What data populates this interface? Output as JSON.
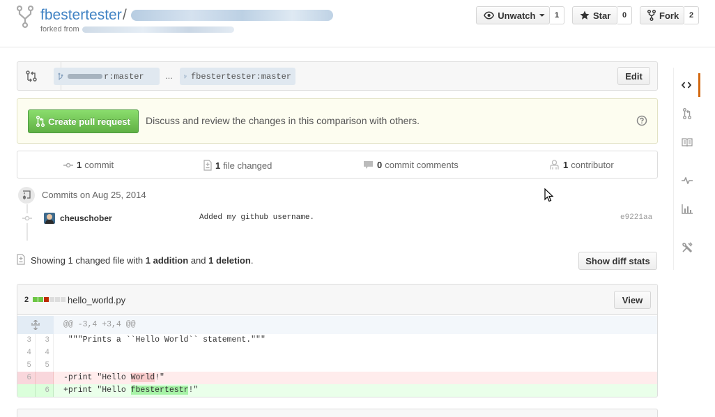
{
  "header": {
    "owner": "fbestertester",
    "slash": "/",
    "forked_from_label": "forked from",
    "unwatch": {
      "label": "Unwatch",
      "count": "1"
    },
    "star": {
      "label": "Star",
      "count": "0"
    },
    "fork": {
      "label": "Fork",
      "count": "2"
    }
  },
  "compare": {
    "base_suffix": "r:master",
    "ellipsis": "...",
    "head": "fbestertester:master",
    "edit_label": "Edit"
  },
  "flash": {
    "button_label": "Create pull request",
    "message": "Discuss and review the changes in this comparison with others."
  },
  "summary": {
    "commits": {
      "count": "1",
      "label": "commit"
    },
    "files": {
      "count": "1",
      "label": "file changed"
    },
    "comments": {
      "count": "0",
      "label": "commit comments"
    },
    "contributors": {
      "count": "1",
      "label": "contributor"
    }
  },
  "commits": {
    "date_heading": "Commits on Aug 25, 2014",
    "items": [
      {
        "author": "cheuschober",
        "message": "Added my github username.",
        "sha": "e9221aa"
      }
    ]
  },
  "toc": {
    "prefix": "Showing 1 changed file with",
    "additions": "1 addition",
    "and": "and",
    "deletions": "1 deletion",
    "suffix": ".",
    "button_label": "Show diff stats"
  },
  "file": {
    "changes": "2",
    "name": "hello_world.py",
    "view_label": "View",
    "diffstat_colors": [
      "#6cc644",
      "#6cc644",
      "#bd2c00",
      "#ddd",
      "#ddd",
      "#ddd"
    ],
    "hunk": "@@ -3,4 +3,4 @@",
    "lines": [
      {
        "old": "3",
        "new": "3",
        "code": " \"\"\"Prints a ``Hello World`` statement.\"\"\""
      },
      {
        "old": "4",
        "new": "4",
        "code": ""
      },
      {
        "old": "5",
        "new": "5",
        "code": ""
      }
    ],
    "deleted": {
      "old": "6",
      "prefix": "-print \"Hello ",
      "highlight": "World",
      "suffix": "!\""
    },
    "added": {
      "new": "6",
      "prefix": "+print \"Hello ",
      "highlight": "fbestertestr",
      "suffix": "!\""
    }
  },
  "colors": {
    "link": "#4183c4",
    "create_button": "#60b044",
    "nav_active": "#d26911"
  }
}
